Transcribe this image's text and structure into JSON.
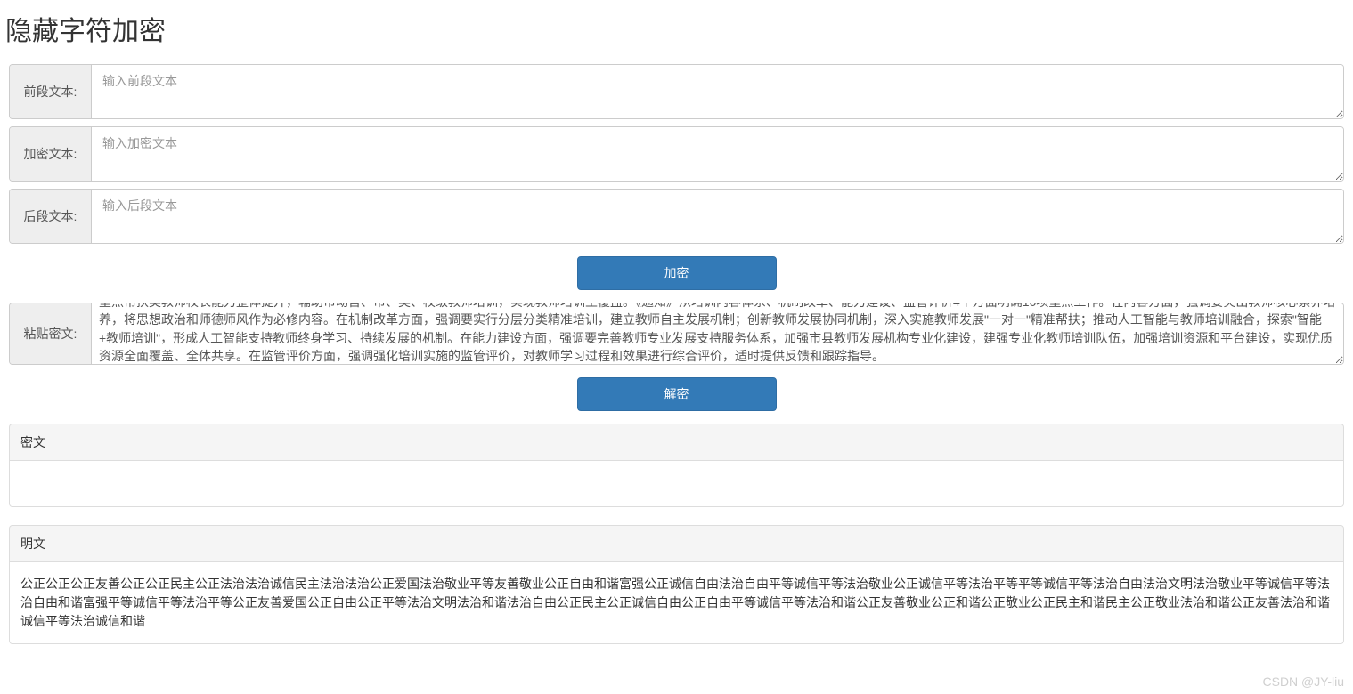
{
  "title": "隐藏字符加密",
  "inputs": {
    "prefix": {
      "label": "前段文本:",
      "placeholder": "输入前段文本",
      "value": ""
    },
    "cipher": {
      "label": "加密文本:",
      "placeholder": "输入加密文本",
      "value": ""
    },
    "suffix": {
      "label": "后段文本:",
      "placeholder": "输入后段文本",
      "value": ""
    }
  },
  "buttons": {
    "encrypt": "加密",
    "decrypt": "解密"
  },
  "paste": {
    "label": "粘贴密文:",
    "value": "重点帮扶类教师校长能力整体提升，辅助市动首、市、类、校级教师培训，实现教师培训主覆盖。《通知》从培训内容体系、机制改革、能力建设、监管评价4个方面明确10项重点工作。在内容方面，强调要突出教师核心素养培养，将思想政治和师德师风作为必修内容。在机制改革方面，强调要实行分层分类精准培训，建立教师自主发展机制；创新教师发展协同机制，深入实施教师发展\"一对一\"精准帮扶；推动人工智能与教师培训融合，探索\"智能+教师培训\"，形成人工智能支持教师终身学习、持续发展的机制。在能力建设方面，强调要完善教师专业发展支持服务体系，加强市县教师发展机构专业化建设，建强专业化教师培训队伍，加强培训资源和平台建设，实现优质资源全面覆盖、全体共享。在监管评价方面，强调强化培训实施的监管评价，对教师学习过程和效果进行综合评价，适时提供反馈和跟踪指导。"
  },
  "sections": {
    "cipher_header": "密文",
    "cipher_body": "",
    "plain_header": "明文",
    "plain_body": "公正公正公正友善公正公正民主公正法治法治诚信民主法治法治公正爱国法治敬业平等友善敬业公正自由和谐富强公正诚信自由法治自由平等诚信平等法治敬业公正诚信平等法治平等平等诚信平等法治自由法治文明法治敬业平等诚信平等法治自由和谐富强平等诚信平等法治平等公正友善爱国公正自由公正平等法治文明法治和谐法治自由公正民主公正诚信自由公正自由平等诚信平等法治和谐公正友善敬业公正和谐公正敬业公正民主和谐民主公正敬业法治和谐公正友善法治和谐诚信平等法治诚信和谐"
  },
  "watermark": "CSDN @JY-liu"
}
